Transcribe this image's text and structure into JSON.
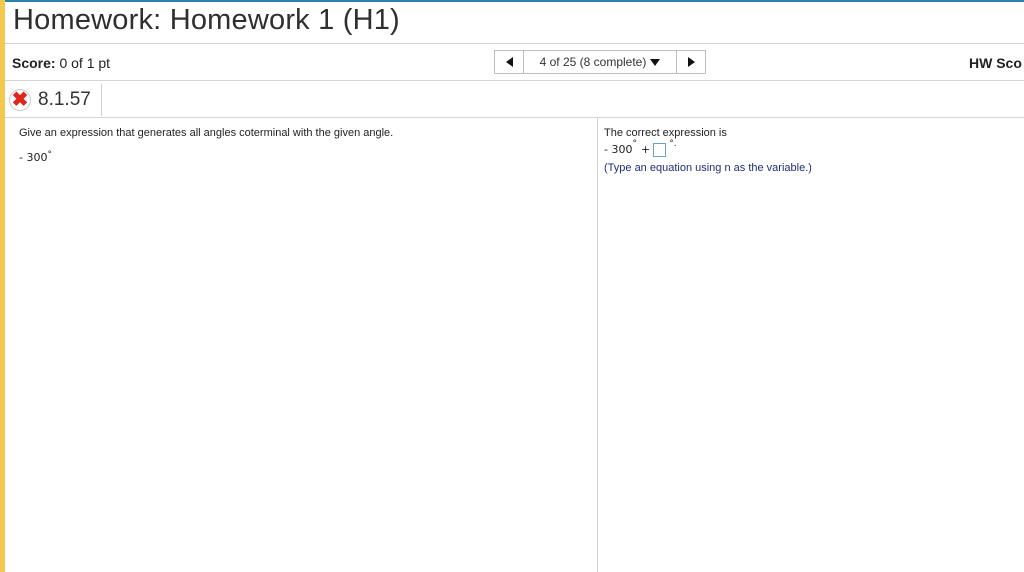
{
  "header": {
    "title": "Homework: Homework 1 (H1)"
  },
  "scorebar": {
    "score_label": "Score:",
    "score_value": "0 of 1 pt",
    "nav_position": "4 of 25 (8 complete)",
    "hw_score_label": "HW Sco"
  },
  "question": {
    "number": "8.1.57",
    "status_icon": "x-mark-icon",
    "status_color": "#e0261c",
    "prompt": "Give an expression that generates all angles coterminal with the given angle.",
    "angle_value": "- 300",
    "angle_unit": "°"
  },
  "answer": {
    "heading": "The correct expression is",
    "expr_prefix": "- 300",
    "expr_unit": "°",
    "expr_plus": "+",
    "expr_suffix": "°.",
    "hint": "(Type an equation using n as the variable.)",
    "hint_color": "#1f2f7a"
  },
  "colors": {
    "accent_top": "#2b7fa8",
    "side_bar": "#f2c94c"
  }
}
